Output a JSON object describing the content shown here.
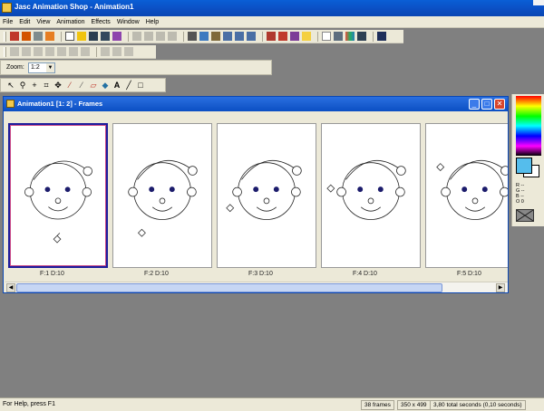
{
  "app": {
    "title": "Jasc Animation Shop - Animation1"
  },
  "menu": [
    "File",
    "Edit",
    "View",
    "Animation",
    "Effects",
    "Window",
    "Help"
  ],
  "zoom": {
    "label": "Zoom:",
    "value": "1:2"
  },
  "document": {
    "title": "Animation1 [1: 2] - Frames"
  },
  "frames": [
    {
      "label": "F:1  D:10",
      "selected": true
    },
    {
      "label": "F:2  D:10",
      "selected": false
    },
    {
      "label": "F:3  D:10",
      "selected": false
    },
    {
      "label": "F:4  D:10",
      "selected": false
    },
    {
      "label": "F:5  D:10",
      "selected": false
    }
  ],
  "colors": {
    "foreground": "#55bdec",
    "background": "#ffffff",
    "rgb": {
      "r": "R --",
      "g": "G --",
      "b": "B --",
      "o": "O 0"
    }
  },
  "status": {
    "help": "For Help, press F1",
    "frames": "38 frames",
    "size": "350 x 499",
    "duration": "3,80 total seconds  (0,10 seconds)"
  },
  "accent": "#0b4fc3"
}
